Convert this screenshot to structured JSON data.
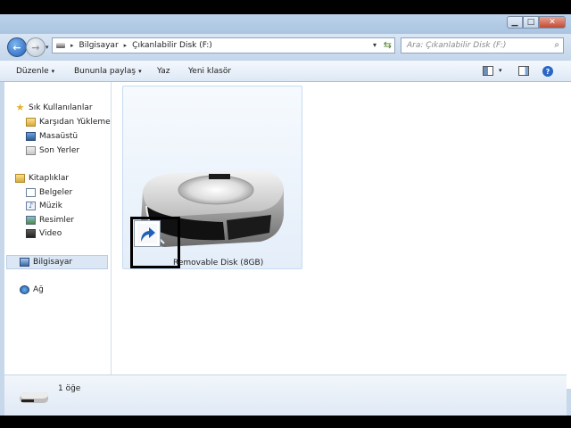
{
  "window": {
    "buttons": {
      "minimize": "▁",
      "maximize": "□",
      "close": "✕"
    }
  },
  "address": {
    "crumbs": [
      "Bilgisayar",
      "Çıkanlabilir Disk (F:)"
    ],
    "separator": "▸",
    "dropdown": "▾",
    "refresh": "⇆"
  },
  "search": {
    "placeholder": "Ara: Çıkanlabilir Disk (F:)",
    "icon": "search-icon"
  },
  "toolbar": {
    "organize": "Düzenle",
    "share": "Bununla paylaş",
    "burn": "Yaz",
    "new_folder": "Yeni klasör",
    "arrow": "▾",
    "help": "?"
  },
  "sidebar": {
    "favorites": {
      "label": "Sık Kullanılanlar",
      "items": [
        "Karşıdan Yüklemeler",
        "Masaüstü",
        "Son Yerler"
      ]
    },
    "libraries": {
      "label": "Kitaplıklar",
      "items": [
        "Belgeler",
        "Müzik",
        "Resimler",
        "Video"
      ]
    },
    "computer": "Bilgisayar",
    "network": "Ağ"
  },
  "content": {
    "item_label": "Removable Disk (8GB)"
  },
  "details": {
    "count_text": "1 öğe"
  },
  "colors": {
    "selection_box": "#000000",
    "tile_bg": "#e4eef9",
    "accent": "#1f5fb8"
  }
}
